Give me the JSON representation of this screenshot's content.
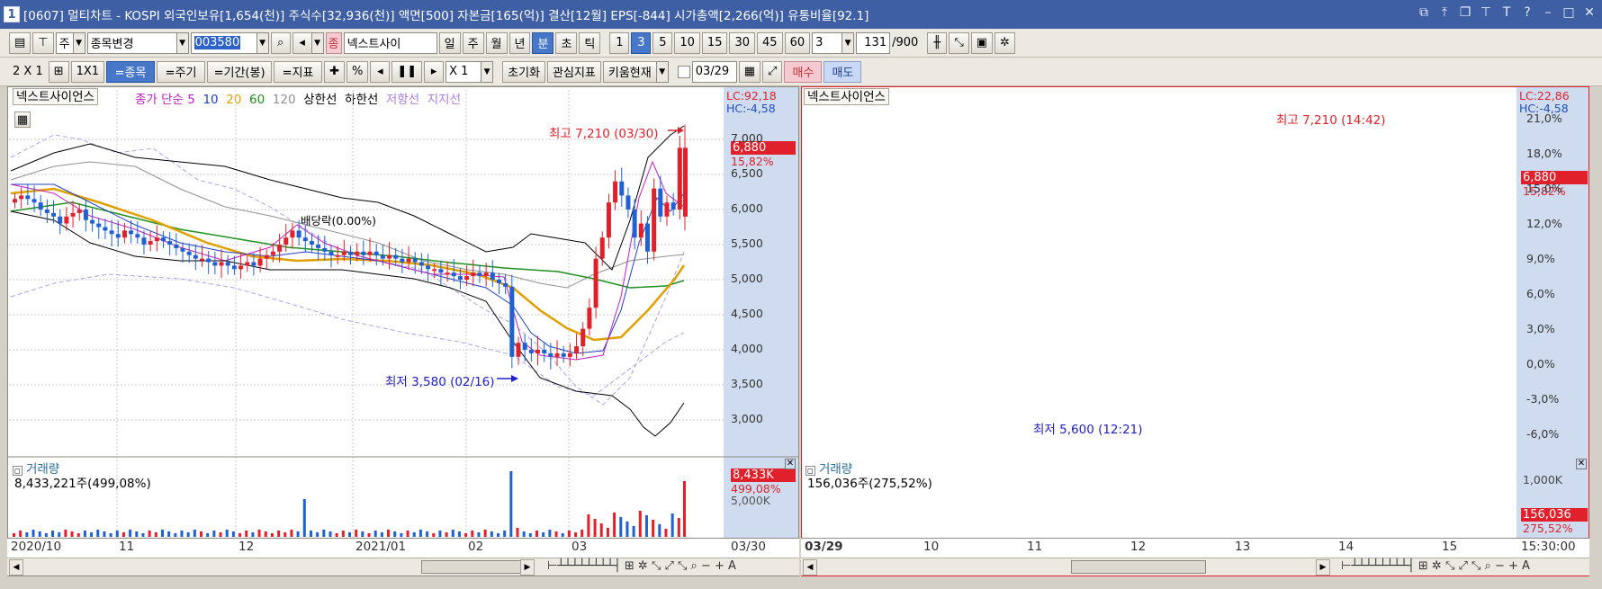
{
  "window": {
    "badge": "1",
    "title": "[0607] 멀티차트 - KOSPI 외국인보유[1,654(천)] 주식수[32,936(천)] 액면[500] 자본금[165(억)] 결산[12월] EPS[-844] 시가총액[2,266(억)] 유통비율[92.1]",
    "controls": [
      "⧉",
      "⤒",
      "❐",
      "⊤",
      "T",
      "?",
      "–",
      "□",
      "✕"
    ]
  },
  "toolbar1": {
    "period_sel": "주",
    "stock_change": "종목변경",
    "code": "003580",
    "badge": "종",
    "stock_name": "넥스트사이",
    "period_tabs": [
      "일",
      "주",
      "월",
      "년",
      "분",
      "초",
      "틱"
    ],
    "minute_opts": [
      "1",
      "3",
      "5",
      "10",
      "15",
      "30",
      "45",
      "60"
    ],
    "interval": "3",
    "count": "131",
    "count_max": "/900"
  },
  "toolbar2": {
    "layout": "2 X 1",
    "grid_1x1": "1X1",
    "btn_stock": "=종목",
    "btn_cycle": "=주기",
    "btn_range": "=기간(봉)",
    "btn_indicator": "=지표",
    "pct": "%",
    "zoom": "X 1",
    "reset": "초기화",
    "interest": "관심지표",
    "kiwoom": "키움현재",
    "date": "03/29",
    "buy": "매수",
    "sell": "매도"
  },
  "left_chart": {
    "stock_tab": "넥스트사이언스",
    "legend": [
      {
        "text": "종가 단순 5",
        "color": "#c020c0"
      },
      {
        "text": "10",
        "color": "#2040c0"
      },
      {
        "text": "20",
        "color": "#e0a000"
      },
      {
        "text": "60",
        "color": "#209020"
      },
      {
        "text": "120",
        "color": "#909090"
      },
      {
        "text": "상한선",
        "color": "#000000"
      },
      {
        "text": "하한선",
        "color": "#000000"
      },
      {
        "text": "저항선",
        "color": "#b080e0"
      },
      {
        "text": "지지선",
        "color": "#b080e0"
      }
    ],
    "lc": "LC:92,18",
    "hc": "HC:-4,58",
    "price_badge": "6,880",
    "pct_badge": "15,82%",
    "y_ticks": [
      "7,000",
      "6,500",
      "6,000",
      "5,500",
      "5,000",
      "4,500",
      "4,000",
      "3,500",
      "3,000"
    ],
    "high_label": "최고 7,210 (03/30)",
    "low_label": "최저 3,580 (02/16)",
    "dividend_label": "배당락(0.00%)",
    "volume_title": "거래량",
    "volume_value": "8,433,221주(499,08%)",
    "vol_badge": "8,433K",
    "vol_pct": "499,08%",
    "vol_tick": "5,000K",
    "x_ticks": [
      "2020/10",
      "11",
      "12",
      "2021/01",
      "02",
      "03"
    ],
    "x_end": "03/30"
  },
  "right_chart": {
    "stock_tab": "넥스트사이언스",
    "lc": "LC:22,86",
    "hc": "HC:-4,58",
    "price_badge": "6,880",
    "pct_badge": "15,82%",
    "y_ticks": [
      "21,0%",
      "18,0%",
      "15,0%",
      "12,0%",
      "9,0%",
      "6,0%",
      "3,0%",
      "0,0%",
      "-3,0%",
      "-6,0%"
    ],
    "high_label": "최고 7,210 (14:42)",
    "low_label": "최저 5,600 (12:21)",
    "volume_title": "거래량",
    "volume_value": "156,036주(275,52%)",
    "vol_tick": "1,000K",
    "vol_badge": "156,036",
    "vol_pct": "275,52%",
    "x_ticks": [
      "03/29",
      "10",
      "11",
      "12",
      "13",
      "14",
      "15"
    ],
    "x_end": "15:30:00"
  },
  "colors": {
    "up": "#e0202a",
    "down": "#2060d0",
    "axis_bg": "#cfdcef",
    "title_bg": "#3f5fa5"
  }
}
